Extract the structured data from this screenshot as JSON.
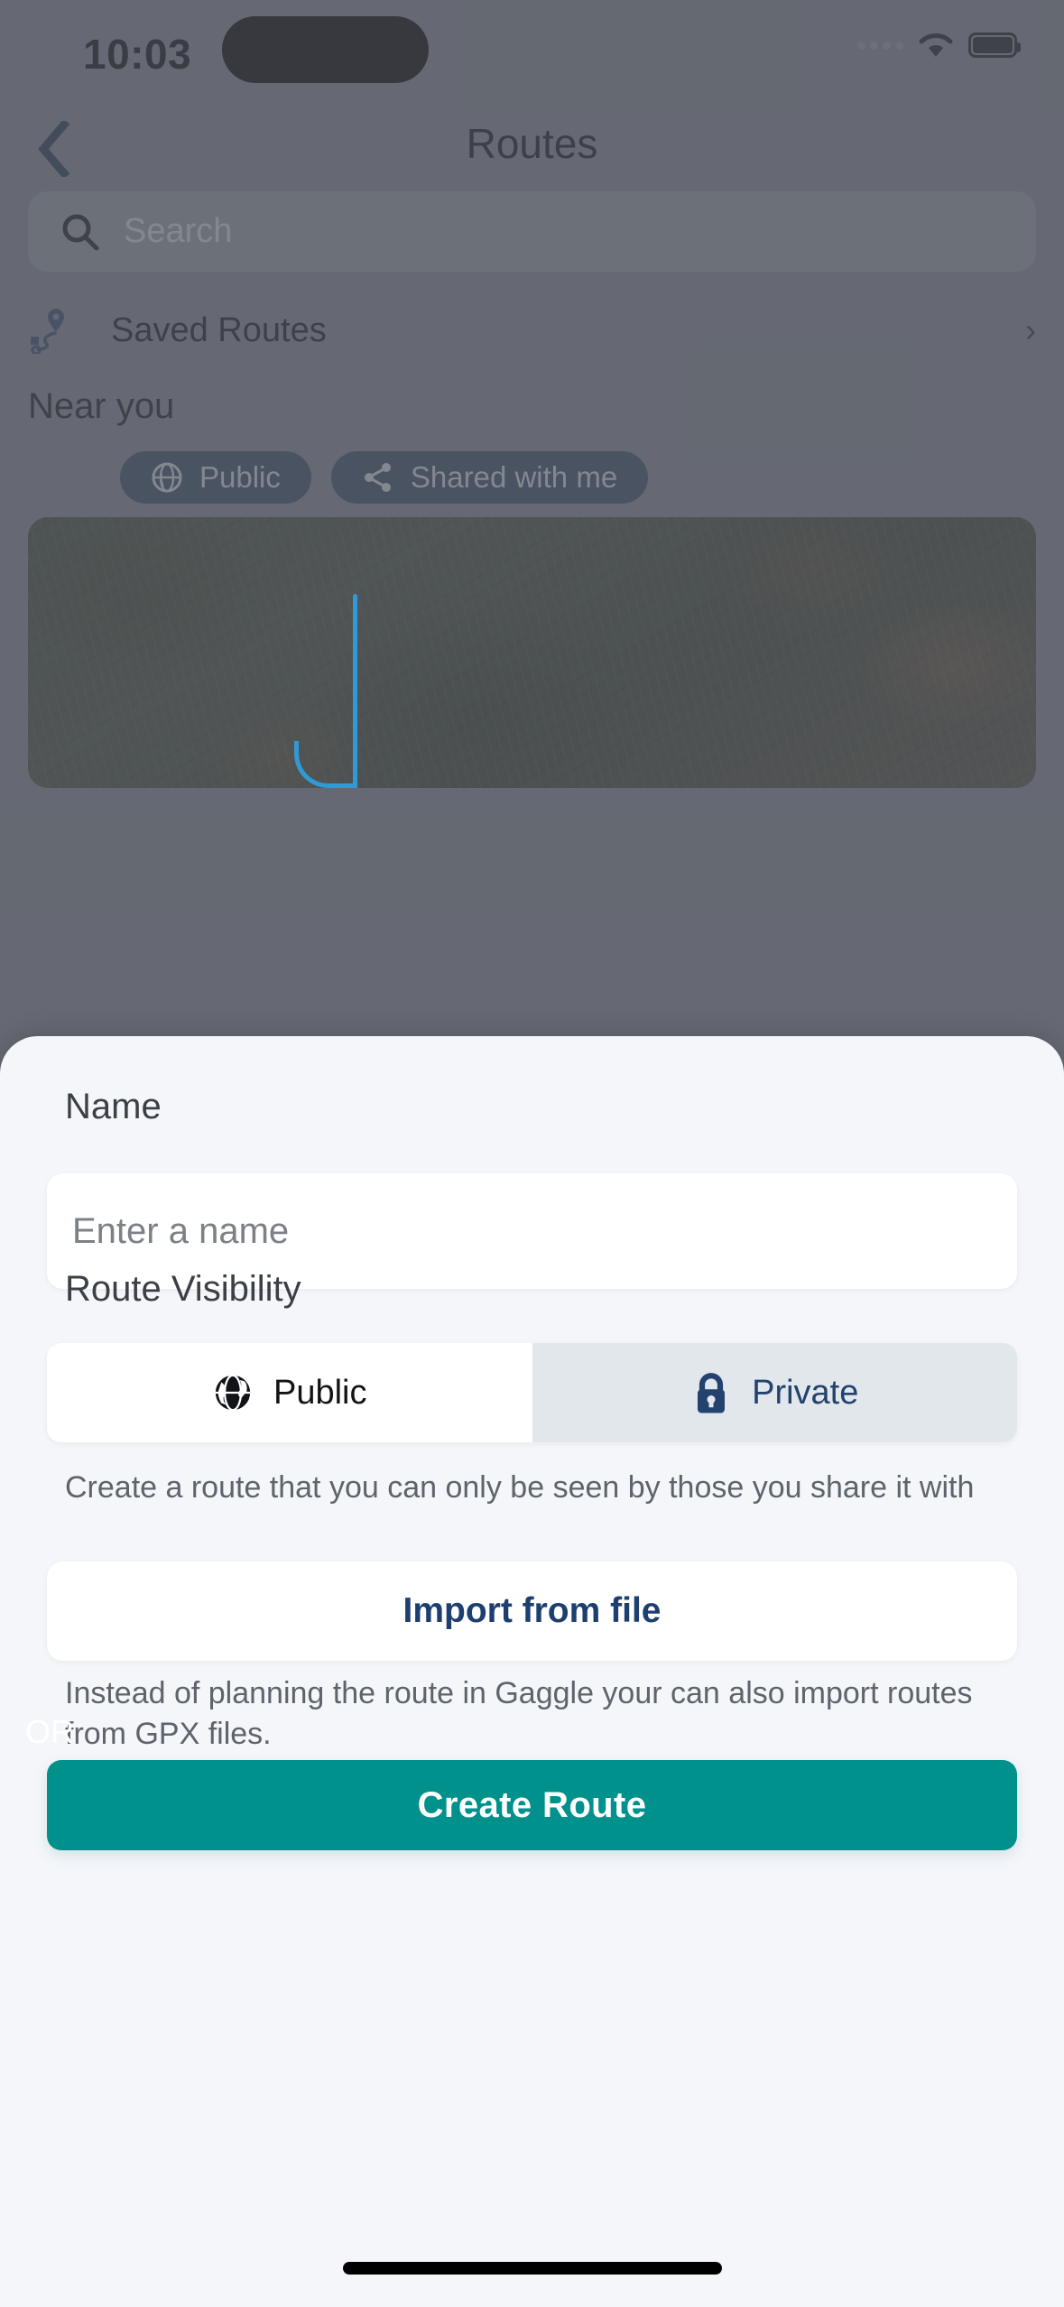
{
  "status_bar": {
    "time": "10:03",
    "signal_icon": "signal-dots-icon",
    "wifi_icon": "wifi-icon",
    "battery_icon": "battery-icon"
  },
  "header": {
    "back_icon": "chevron-left-icon",
    "title": "Routes"
  },
  "search": {
    "icon": "search-icon",
    "placeholder": "Search",
    "value": ""
  },
  "saved_routes": {
    "icon": "route-pin-icon",
    "label": "Saved Routes",
    "chevron": "chevron-right-icon"
  },
  "near_you": {
    "heading": "Near you",
    "chips": [
      {
        "label": "Public",
        "icon": "globe-icon"
      },
      {
        "label": "Shared with me",
        "icon": "share-icon"
      }
    ]
  },
  "sheet": {
    "name": {
      "label": "Name",
      "placeholder": "Enter a name",
      "value": ""
    },
    "visibility": {
      "label": "Route Visibility",
      "options": [
        {
          "label": "Public",
          "icon": "globe-icon",
          "selected": false
        },
        {
          "label": "Private",
          "icon": "lock-icon",
          "selected": true
        }
      ],
      "helper": "Create a route that you can only be seen by those you share it with"
    },
    "import": {
      "button_label": "Import from file",
      "helper": "Instead of planning the route in Gaggle your can also import routes from GPX files."
    },
    "or_label": "OR",
    "create_button_label": "Create Route"
  },
  "colors": {
    "accent_teal": "#00918d",
    "navy": "#1d3f70",
    "sheet_bg": "#f4f6fa",
    "chip_bg": "#32465e",
    "segment_selected_bg": "#e2e7ec"
  }
}
